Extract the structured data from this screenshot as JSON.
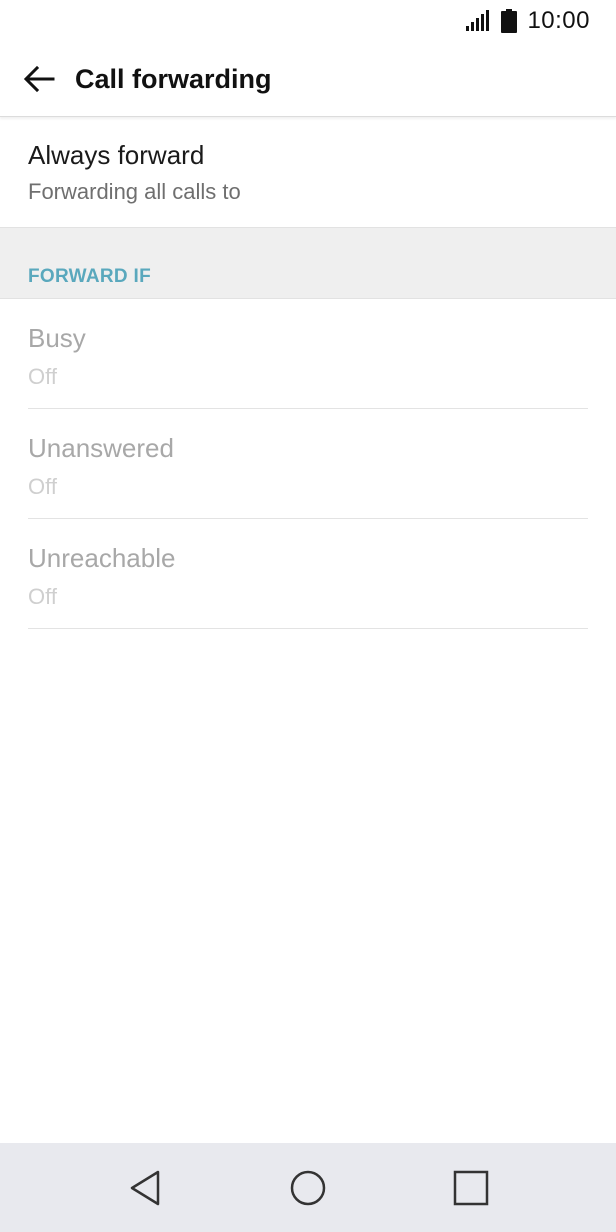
{
  "status_bar": {
    "time": "10:00",
    "icons": [
      "signal-icon",
      "battery-icon"
    ]
  },
  "app_bar": {
    "title": "Call forwarding",
    "back_icon": "arrow-left-icon"
  },
  "always_forward": {
    "title": "Always forward",
    "subtitle": "Forwarding all calls to"
  },
  "section": {
    "label": "FORWARD IF",
    "color": "#5aa8bd"
  },
  "forward_items": [
    {
      "title": "Busy",
      "value": "Off"
    },
    {
      "title": "Unanswered",
      "value": "Off"
    },
    {
      "title": "Unreachable",
      "value": "Off"
    }
  ],
  "nav_bar": {
    "icons": [
      "back-triangle-icon",
      "home-circle-icon",
      "recents-square-icon"
    ]
  }
}
